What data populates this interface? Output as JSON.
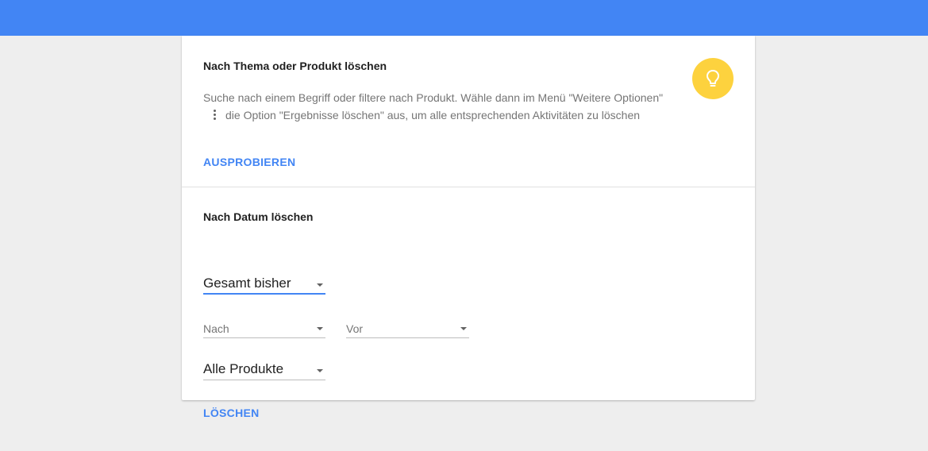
{
  "topic_section": {
    "title": "Nach Thema oder Produkt löschen",
    "description_part1": "Suche nach einem Begriff oder filtere nach Produkt. Wähle dann im Menü \"Weitere Optionen\"",
    "description_part2": "die Option \"Ergebnisse löschen\" aus, um alle entsprechenden Aktivitäten zu löschen",
    "action_label": "AUSPROBIEREN",
    "icon": "lightbulb-icon"
  },
  "date_section": {
    "title": "Nach Datum löschen",
    "range_selected": "Gesamt bisher",
    "after_label": "Nach",
    "before_label": "Vor",
    "product_selected": "Alle Produkte",
    "action_label": "LÖSCHEN"
  },
  "colors": {
    "topbar": "#4285f4",
    "accent": "#4285f4",
    "bulb": "#fdd23e",
    "background": "#eeeeee"
  }
}
